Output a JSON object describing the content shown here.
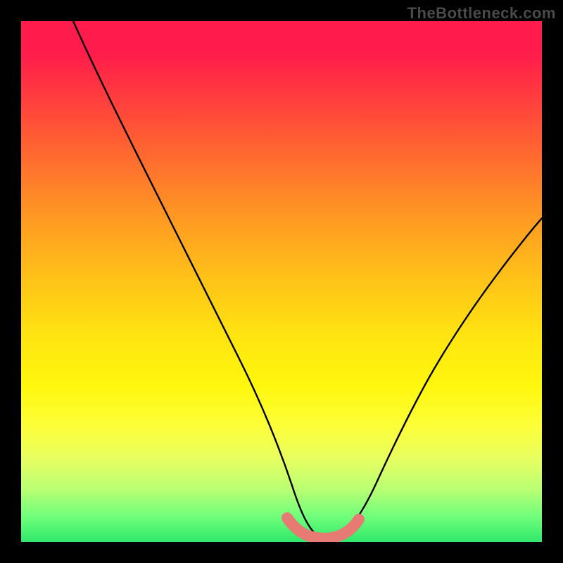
{
  "watermark": "TheBottleneck.com",
  "chart_data": {
    "type": "line",
    "title": "",
    "xlabel": "",
    "ylabel": "",
    "xlim": [
      0,
      100
    ],
    "ylim": [
      0,
      100
    ],
    "background": "rainbow-vertical-gradient",
    "series": [
      {
        "name": "main-curve",
        "color": "#000000",
        "x": [
          10,
          15,
          20,
          25,
          30,
          35,
          40,
          45,
          50,
          52,
          55,
          58,
          60,
          64,
          68,
          72,
          76,
          80,
          85,
          90,
          95,
          100
        ],
        "y": [
          100,
          90,
          79,
          68,
          57,
          46,
          35,
          24,
          13,
          8,
          4,
          2,
          1.5,
          2,
          5,
          11,
          19,
          28,
          38,
          47,
          55,
          62
        ]
      },
      {
        "name": "bottom-highlight",
        "color": "#e77a72",
        "x": [
          50,
          52,
          54,
          56,
          58,
          60,
          62,
          64
        ],
        "y": [
          4,
          2.5,
          2,
          1.8,
          1.8,
          2,
          2.5,
          4
        ]
      }
    ],
    "gradient_stops": [
      {
        "pos": 0,
        "color": "#ff1b4b"
      },
      {
        "pos": 6,
        "color": "#ff1b4b"
      },
      {
        "pos": 14,
        "color": "#ff3a3f"
      },
      {
        "pos": 26,
        "color": "#ff6a2f"
      },
      {
        "pos": 38,
        "color": "#ff9a22"
      },
      {
        "pos": 50,
        "color": "#ffc418"
      },
      {
        "pos": 60,
        "color": "#ffe311"
      },
      {
        "pos": 70,
        "color": "#fff70d"
      },
      {
        "pos": 78,
        "color": "#fcff3a"
      },
      {
        "pos": 84,
        "color": "#e8ff60"
      },
      {
        "pos": 90,
        "color": "#b8ff74"
      },
      {
        "pos": 95,
        "color": "#72ff7c"
      },
      {
        "pos": 100,
        "color": "#30e86a"
      }
    ]
  }
}
